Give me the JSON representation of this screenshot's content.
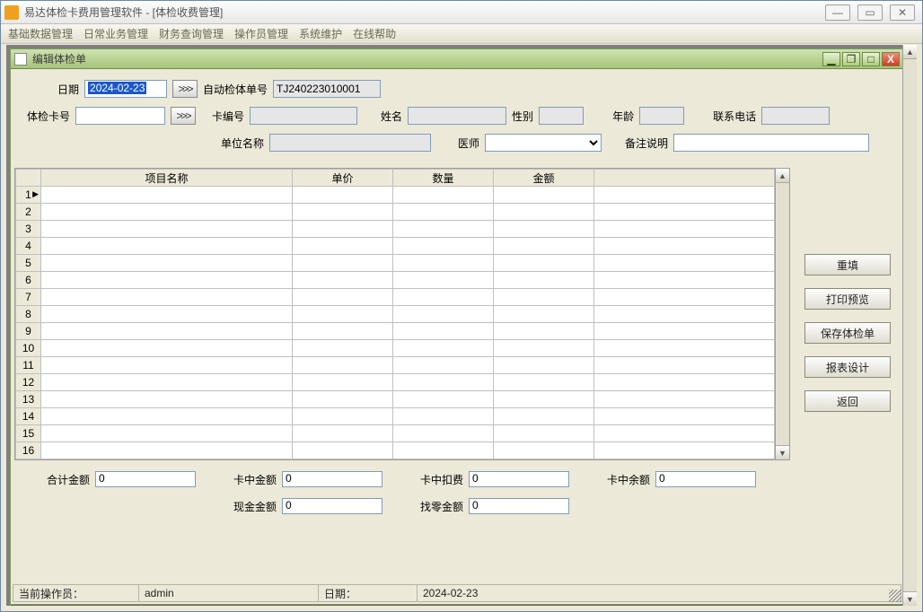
{
  "app": {
    "title": "易达体检卡费用管理软件    - [体检收费管理]"
  },
  "menu": [
    "基础数据管理",
    "日常业务管理",
    "财务查询管理",
    "操作员管理",
    "系统维护",
    "在线帮助"
  ],
  "child": {
    "title": "编辑体检单"
  },
  "labels": {
    "date": "日期",
    "auto_no": "自动检体单号",
    "card_no": "体检卡号",
    "card_id": "卡编号",
    "name": "姓名",
    "sex": "性别",
    "age": "年龄",
    "phone": "联系电话",
    "company": "单位名称",
    "doctor": "医师",
    "remark": "备注说明"
  },
  "form": {
    "date": "2024-02-23",
    "auto_no": "TJ240223010001",
    "card_no": "",
    "card_id": "",
    "name": "",
    "sex": "",
    "age": "",
    "phone": "",
    "company": "",
    "doctor": "",
    "remark": ""
  },
  "grid": {
    "headers": [
      "项目名称",
      "单价",
      "数量",
      "金额"
    ],
    "rows": 16
  },
  "side_buttons": [
    "重填",
    "打印预览",
    "保存体检单",
    "报表设计",
    "返回"
  ],
  "totals": {
    "labels": {
      "total": "合计金额",
      "card_amount": "卡中金额",
      "card_deduct": "卡中扣费",
      "card_balance": "卡中余额",
      "cash": "现金金额",
      "change": "找零金额"
    },
    "values": {
      "total": "0",
      "card_amount": "0",
      "card_deduct": "0",
      "card_balance": "0",
      "cash": "0",
      "change": "0"
    }
  },
  "status": {
    "operator_label": "当前操作员：",
    "operator": "admin",
    "date_label": "日期：",
    "date": "2024-02-23"
  },
  "glyphs": {
    "more": ">>>"
  }
}
